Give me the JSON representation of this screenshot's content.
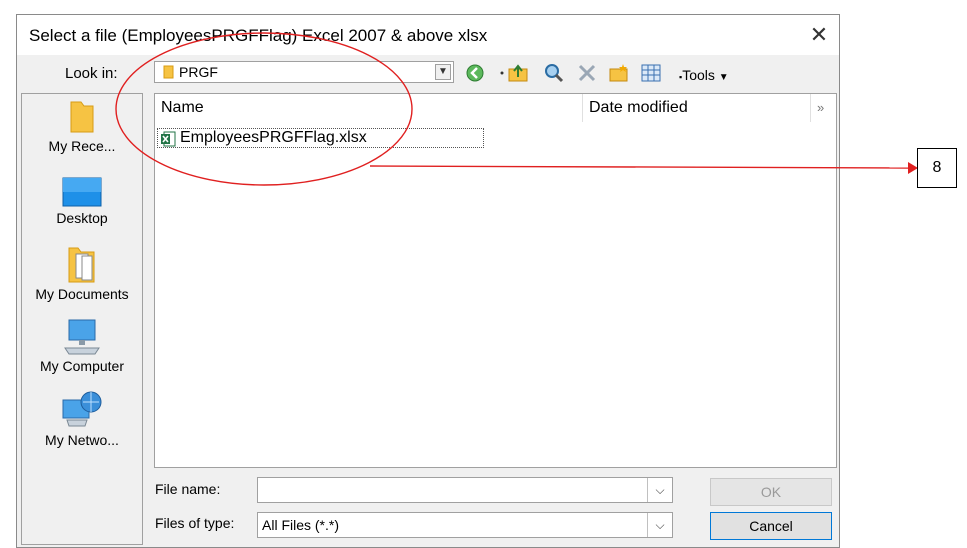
{
  "dialog": {
    "title": "Select a file (EmployeesPRGFFlag) Excel 2007 & above xlsx",
    "close_label": "✕"
  },
  "lookin": {
    "label": "Look in:",
    "value": "PRGF"
  },
  "toolbar": {
    "tools_label": "Tools",
    "icons": [
      "back-icon",
      "up-folder-icon",
      "search-web-icon",
      "delete-icon",
      "new-folder-icon",
      "views-icon"
    ]
  },
  "places": [
    {
      "label": "My Rece...",
      "icon": "recent-folder-icon"
    },
    {
      "label": "Desktop",
      "icon": "desktop-icon"
    },
    {
      "label": "My Documents",
      "icon": "documents-icon"
    },
    {
      "label": "My Computer",
      "icon": "computer-icon"
    },
    {
      "label": "My Netwo...",
      "icon": "network-icon"
    }
  ],
  "filelist": {
    "columns": [
      "Name",
      "Date modified"
    ],
    "more": "»",
    "files": [
      {
        "name": "EmployeesPRGFFlag.xlsx",
        "icon": "excel-icon"
      }
    ]
  },
  "form": {
    "filename_label": "File name:",
    "filename_value": "",
    "filetype_label": "Files of type:",
    "filetype_value": "All Files (*.*)"
  },
  "buttons": {
    "ok": "OK",
    "cancel": "Cancel"
  },
  "annotation": {
    "callout_number": "8",
    "color": "#e02020"
  }
}
